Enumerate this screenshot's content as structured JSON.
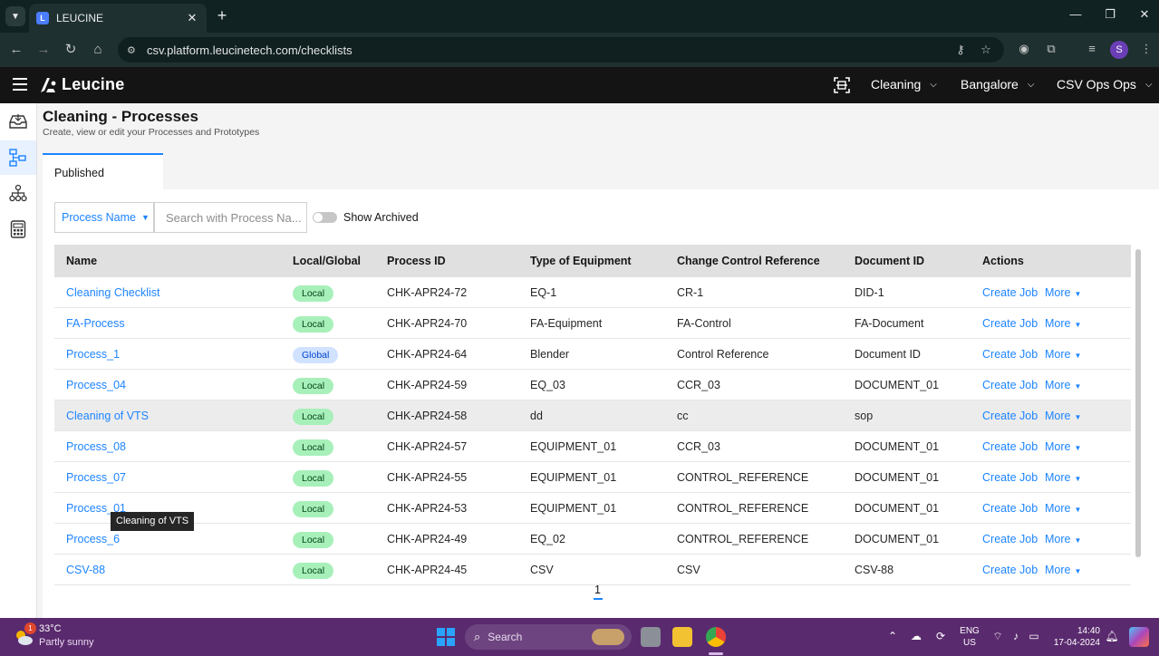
{
  "browser": {
    "tab_title": "LEUCINE",
    "tab_close": "✕",
    "new_tab": "+",
    "url": "csv.platform.leucinetech.com/checklists",
    "profile_initial": "S"
  },
  "header": {
    "logo_text": "Leucine",
    "dropdowns": [
      "Cleaning",
      "Bangalore",
      "CSV Ops Ops"
    ]
  },
  "page": {
    "title": "Cleaning - Processes",
    "subtitle": "Create, view or edit your Processes and Prototypes",
    "tab_published": "Published"
  },
  "filters": {
    "field_select": "Process Name",
    "search_placeholder": "Search with Process Na...",
    "show_archived_label": "Show Archived",
    "show_archived_on": false
  },
  "table": {
    "columns": [
      "Name",
      "Local/Global",
      "Process ID",
      "Type of Equipment",
      "Change Control Reference",
      "Document ID",
      "Actions"
    ],
    "rows": [
      {
        "name": "Cleaning Checklist",
        "scope": "Local",
        "id": "CHK-APR24-72",
        "equipment": "EQ-1",
        "ccr": "CR-1",
        "doc": "DID-1",
        "action": "Create Job",
        "more": "More"
      },
      {
        "name": "FA-Process",
        "scope": "Local",
        "id": "CHK-APR24-70",
        "equipment": "FA-Equipment",
        "ccr": "FA-Control",
        "doc": "FA-Document",
        "action": "Create Job",
        "more": "More"
      },
      {
        "name": "Process_1",
        "scope": "Global",
        "id": "CHK-APR24-64",
        "equipment": "Blender",
        "ccr": "Control Reference",
        "doc": "Document ID",
        "action": "Create Job",
        "more": "More"
      },
      {
        "name": "Process_04",
        "scope": "Local",
        "id": "CHK-APR24-59",
        "equipment": "EQ_03",
        "ccr": "CCR_03",
        "doc": "DOCUMENT_01",
        "action": "Create Job",
        "more": "More"
      },
      {
        "name": "Cleaning of VTS",
        "scope": "Local",
        "id": "CHK-APR24-58",
        "equipment": "dd",
        "ccr": "cc",
        "doc": "sop",
        "action": "Create Job",
        "more": "More"
      },
      {
        "name": "Process_08",
        "scope": "Local",
        "id": "CHK-APR24-57",
        "equipment": "EQUIPMENT_01",
        "ccr": "CCR_03",
        "doc": "DOCUMENT_01",
        "action": "Create Job",
        "more": "More"
      },
      {
        "name": "Process_07",
        "scope": "Local",
        "id": "CHK-APR24-55",
        "equipment": "EQUIPMENT_01",
        "ccr": "CONTROL_REFERENCE",
        "doc": "DOCUMENT_01",
        "action": "Create Job",
        "more": "More"
      },
      {
        "name": "Process_01",
        "scope": "Local",
        "id": "CHK-APR24-53",
        "equipment": "EQUIPMENT_01",
        "ccr": "CONTROL_REFERENCE",
        "doc": "DOCUMENT_01",
        "action": "Create Job",
        "more": "More"
      },
      {
        "name": "Process_6",
        "scope": "Local",
        "id": "CHK-APR24-49",
        "equipment": "EQ_02",
        "ccr": "CONTROL_REFERENCE",
        "doc": "DOCUMENT_01",
        "action": "Create Job",
        "more": "More"
      },
      {
        "name": "CSV-88",
        "scope": "Local",
        "id": "CHK-APR24-45",
        "equipment": "CSV",
        "ccr": "CSV",
        "doc": "CSV-88",
        "action": "Create Job",
        "more": "More"
      }
    ],
    "hovered_row": 4
  },
  "tooltip": "Cleaning of VTS",
  "pagination": {
    "current_page": "1"
  },
  "taskbar": {
    "weather_badge": "1",
    "temperature": "33°C",
    "condition": "Partly sunny",
    "search_label": "Search",
    "lang_line1": "ENG",
    "lang_line2": "US",
    "time": "14:40",
    "date": "17-04-2024"
  },
  "colors": {
    "accent": "#1d84ff",
    "local_badge": "#a7f0ba",
    "global_badge": "#d0e2ff",
    "taskbar": "#5a2a6e",
    "app_header": "#141414"
  }
}
